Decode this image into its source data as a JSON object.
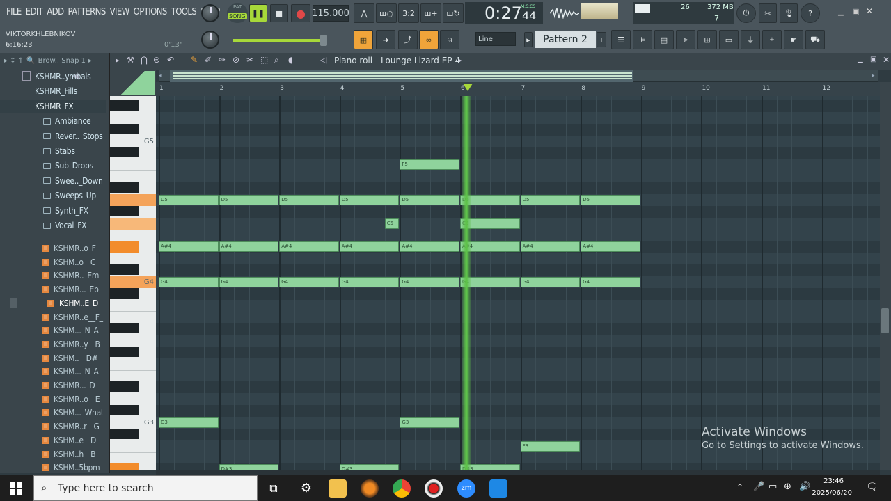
{
  "menu": [
    "FILE",
    "EDIT",
    "ADD",
    "PATTERNS",
    "VIEW",
    "OPTIONS",
    "TOOLS",
    "HELP"
  ],
  "transport": {
    "pat_label": "PAT",
    "song_label": "SONG",
    "tempo": "115.000",
    "time_main": "0:27",
    "time_sub": "44",
    "time_format": "M:S:CS"
  },
  "performance": {
    "cpu_value": "26",
    "memory": "372 MB",
    "poly": "7"
  },
  "user": {
    "name": "VIKTORKHLEBNIKOV",
    "project_time": "6:16:23",
    "hint_time": "0'13\""
  },
  "toolbar2": {
    "snap_mode": "Line",
    "pattern": "Pattern 2"
  },
  "browser": {
    "toolbar_text": "Brow.. Snap 1",
    "items": [
      {
        "label": "KSHMR..ymbals",
        "kind": "folder"
      },
      {
        "label": "KSHMR_Fills",
        "kind": "folder"
      },
      {
        "label": "KSHMR_FX",
        "kind": "folder-open"
      },
      {
        "label": "Ambiance",
        "kind": "subfolder"
      },
      {
        "label": "Rever.._Stops",
        "kind": "subfolder"
      },
      {
        "label": "Stabs",
        "kind": "subfolder"
      },
      {
        "label": "Sub_Drops",
        "kind": "subfolder"
      },
      {
        "label": "Swee.._Down",
        "kind": "subfolder"
      },
      {
        "label": "Sweeps_Up",
        "kind": "subfolder"
      },
      {
        "label": "Synth_FX",
        "kind": "subfolder"
      },
      {
        "label": "Vocal_FX",
        "kind": "subfolder-open"
      },
      {
        "label": "KSHMR..o_F_",
        "kind": "file"
      },
      {
        "label": "KSHM..o__C_",
        "kind": "file"
      },
      {
        "label": "KSHMR.._Em_",
        "kind": "file"
      },
      {
        "label": "KSHMR..._Eb_",
        "kind": "file"
      },
      {
        "label": "KSHM..E_D_",
        "kind": "file-selected"
      },
      {
        "label": "KSHMR..e__F_",
        "kind": "file"
      },
      {
        "label": "KSHM..._N_A_",
        "kind": "file"
      },
      {
        "label": "KSHMR..y__B_",
        "kind": "file"
      },
      {
        "label": "KSHM..__D#_",
        "kind": "file"
      },
      {
        "label": "KSHM..._N_A_",
        "kind": "file"
      },
      {
        "label": "KSHMR..._D_",
        "kind": "file"
      },
      {
        "label": "KSHMR..o__E_",
        "kind": "file"
      },
      {
        "label": "KSHM..._What",
        "kind": "file"
      },
      {
        "label": "KSHMR..r__G_",
        "kind": "file"
      },
      {
        "label": "KSHM..e__D_",
        "kind": "file"
      },
      {
        "label": "KSHM..h__B_",
        "kind": "file"
      },
      {
        "label": "KSHM..5bpm_",
        "kind": "file"
      }
    ]
  },
  "piano_roll": {
    "title": "Piano roll - Lounge Lizard EP-4",
    "bars": [
      "1",
      "2",
      "3",
      "4",
      "5",
      "6",
      "7",
      "8",
      "9",
      "10",
      "11",
      "12"
    ],
    "octave_labels": [
      "G5",
      "G4",
      "G3"
    ],
    "playhead_bar": 6.1,
    "notes": [
      {
        "pitch": "F5",
        "start": 5,
        "length": 1
      },
      {
        "pitch": "D5",
        "start": 1,
        "length": 1
      },
      {
        "pitch": "D5",
        "start": 2,
        "length": 1
      },
      {
        "pitch": "D5",
        "start": 3,
        "length": 1
      },
      {
        "pitch": "D5",
        "start": 4,
        "length": 1
      },
      {
        "pitch": "D5",
        "start": 5,
        "length": 1
      },
      {
        "pitch": "D5",
        "start": 6,
        "length": 1
      },
      {
        "pitch": "D5",
        "start": 7,
        "length": 1
      },
      {
        "pitch": "D5",
        "start": 8,
        "length": 1
      },
      {
        "pitch": "C5",
        "start": 4.75,
        "length": 0.25
      },
      {
        "pitch": "C5",
        "start": 6,
        "length": 1
      },
      {
        "pitch": "A#4",
        "start": 1,
        "length": 1
      },
      {
        "pitch": "A#4",
        "start": 2,
        "length": 1
      },
      {
        "pitch": "A#4",
        "start": 3,
        "length": 1
      },
      {
        "pitch": "A#4",
        "start": 4,
        "length": 1
      },
      {
        "pitch": "A#4",
        "start": 5,
        "length": 1
      },
      {
        "pitch": "A#4",
        "start": 6,
        "length": 1
      },
      {
        "pitch": "A#4",
        "start": 7,
        "length": 1
      },
      {
        "pitch": "A#4",
        "start": 8,
        "length": 1
      },
      {
        "pitch": "G4",
        "start": 1,
        "length": 1
      },
      {
        "pitch": "G4",
        "start": 2,
        "length": 1
      },
      {
        "pitch": "G4",
        "start": 3,
        "length": 1
      },
      {
        "pitch": "G4",
        "start": 4,
        "length": 1
      },
      {
        "pitch": "G4",
        "start": 5,
        "length": 1
      },
      {
        "pitch": "G4",
        "start": 6,
        "length": 1
      },
      {
        "pitch": "G4",
        "start": 7,
        "length": 1
      },
      {
        "pitch": "G4",
        "start": 8,
        "length": 1
      },
      {
        "pitch": "G3",
        "start": 1,
        "length": 1
      },
      {
        "pitch": "G3",
        "start": 5,
        "length": 1
      },
      {
        "pitch": "F3",
        "start": 7,
        "length": 1
      },
      {
        "pitch": "D#3",
        "start": 2,
        "length": 1
      },
      {
        "pitch": "D#3",
        "start": 4,
        "length": 1
      },
      {
        "pitch": "D#3",
        "start": 6,
        "length": 1
      }
    ]
  },
  "watermark": {
    "line1": "Activate Windows",
    "line2": "Go to Settings to activate Windows."
  },
  "taskbar": {
    "search_placeholder": "Type here to search",
    "time": "23:46",
    "date": "2025/06/20"
  },
  "colors": {
    "note": "#8fd39c",
    "playhead": "#5ec24a",
    "accent": "#f28c2b"
  }
}
